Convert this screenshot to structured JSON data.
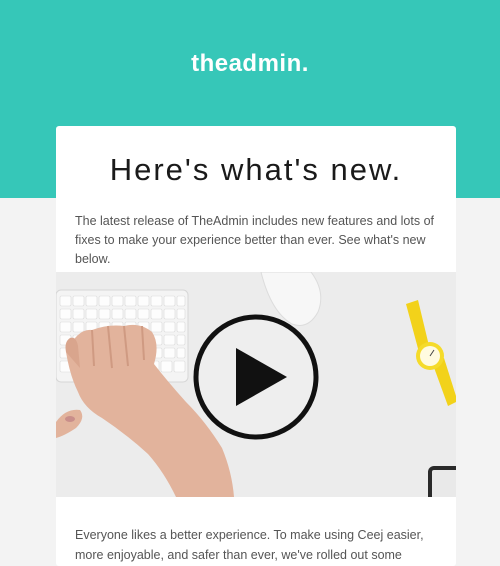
{
  "header": {
    "brand": "theadmin.",
    "brand_color": "#36c7b8"
  },
  "card": {
    "headline": "Here's what's new.",
    "intro": "The latest release of TheAdmin includes new features and lots of fixes to make your experience better than ever. See what's new below.",
    "video": {
      "play_icon": "play-icon"
    },
    "body": "Everyone likes a better experience. To make using Ceej easier, more enjoyable, and safer than ever, we've rolled out some changes to your account. Here's"
  }
}
